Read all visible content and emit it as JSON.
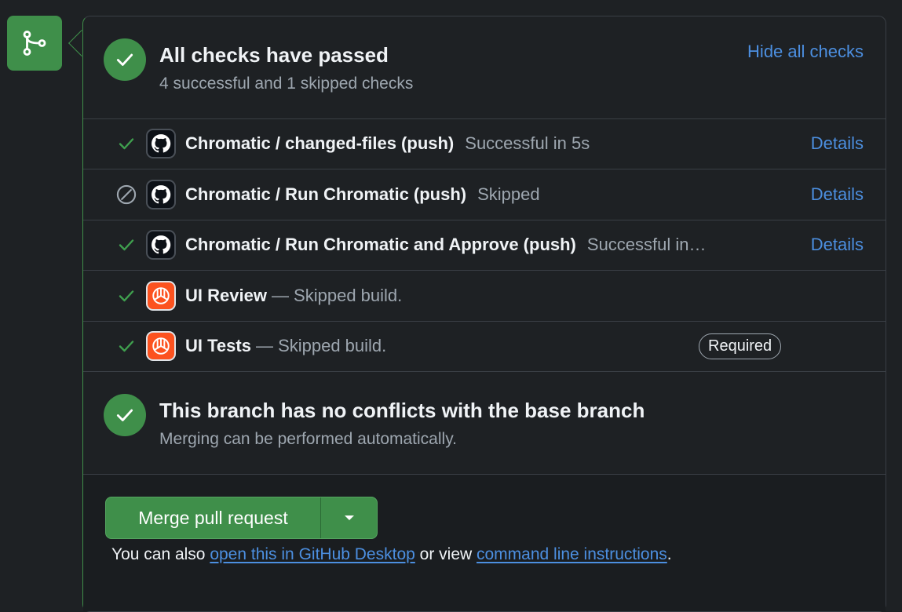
{
  "checks_header": {
    "title": "All checks have passed",
    "subtitle": "4 successful and 1 skipped checks",
    "hide_link": "Hide all checks"
  },
  "checks": [
    {
      "status": "success",
      "app": "github",
      "name": "Chromatic / changed-files (push)",
      "desc": "Successful in 5s",
      "details": "Details"
    },
    {
      "status": "skipped",
      "app": "github",
      "name": "Chromatic / Run Chromatic (push)",
      "desc": "Skipped",
      "details": "Details"
    },
    {
      "status": "success",
      "app": "github",
      "name": "Chromatic / Run Chromatic and Approve (push)",
      "desc": "Successful in…",
      "details": "Details"
    },
    {
      "status": "success",
      "app": "chromatic",
      "name": "UI Review",
      "desc": "— Skipped build."
    },
    {
      "status": "success",
      "app": "chromatic",
      "name": "UI Tests",
      "desc": "— Skipped build.",
      "badge": "Required"
    }
  ],
  "conflicts": {
    "title": "This branch has no conflicts with the base branch",
    "subtitle": "Merging can be performed automatically."
  },
  "merge": {
    "button_label": "Merge pull request",
    "footer_prefix": "You can also ",
    "desktop_link": "open this in GitHub Desktop",
    "footer_middle": " or view ",
    "cli_link": "command line instructions",
    "footer_suffix": "."
  },
  "colors": {
    "success": "#3f8f4a",
    "link": "#4c8fe0",
    "muted": "#9ea7b0",
    "background": "#1e2124"
  },
  "icons": {
    "merge": "git-merge-icon",
    "check": "check-icon",
    "skip": "skip-icon",
    "github": "github-icon",
    "chromatic": "chromatic-icon",
    "caret": "caret-down-icon"
  }
}
